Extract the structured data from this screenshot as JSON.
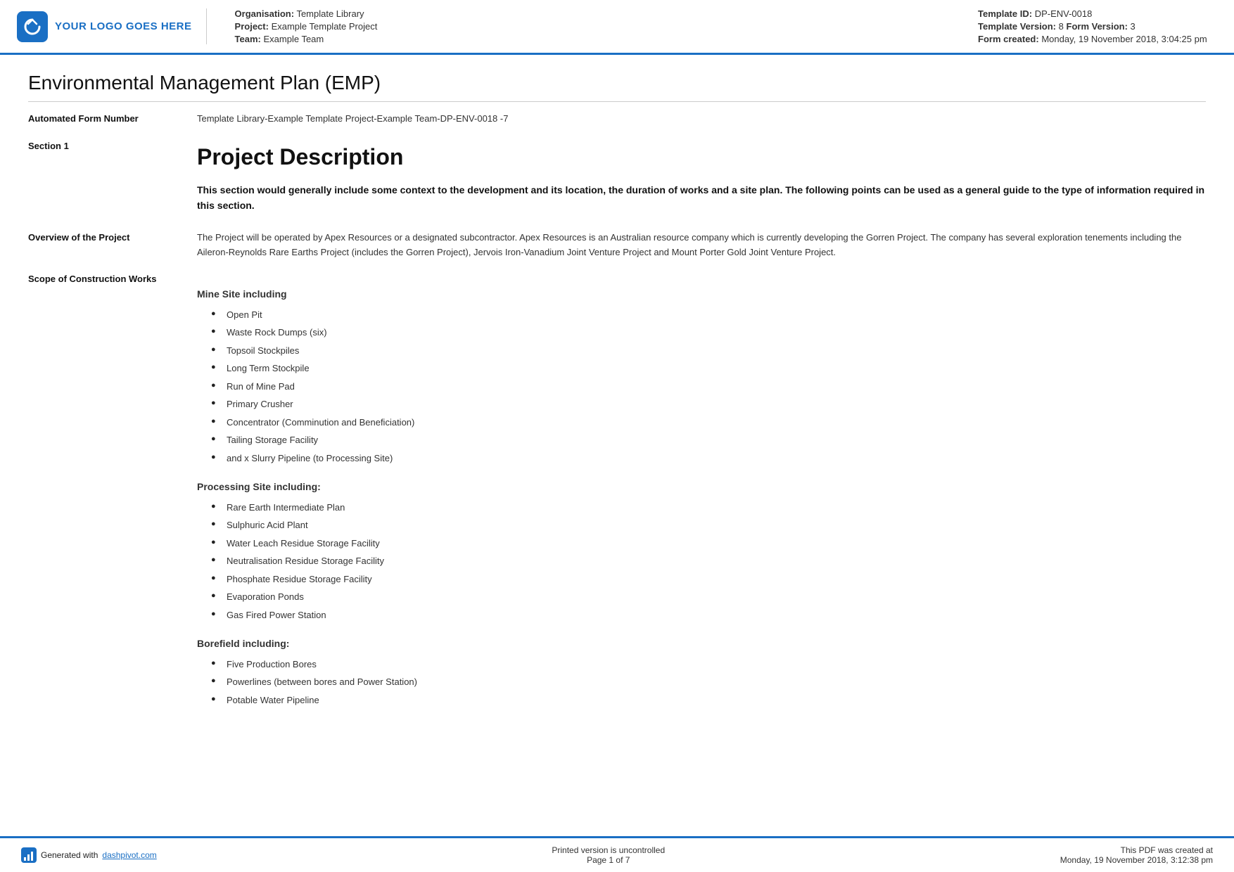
{
  "header": {
    "logo_text": "YOUR LOGO GOES HERE",
    "org_label": "Organisation:",
    "org_value": "Template Library",
    "project_label": "Project:",
    "project_value": "Example Template Project",
    "team_label": "Team:",
    "team_value": "Example Team",
    "template_id_label": "Template ID:",
    "template_id_value": "DP-ENV-0018",
    "template_version_label": "Template Version:",
    "template_version_value": "8",
    "form_version_label": "Form Version:",
    "form_version_value": "3",
    "form_created_label": "Form created:",
    "form_created_value": "Monday, 19 November 2018, 3:04:25 pm"
  },
  "page": {
    "title": "Environmental Management Plan (EMP)"
  },
  "automated_form": {
    "label": "Automated Form Number",
    "value": "Template Library-Example Template Project-Example Team-DP-ENV-0018   -7"
  },
  "section1": {
    "label": "Section 1",
    "heading": "Project Description",
    "intro": "This section would generally include some context to the development and its location, the duration of works and a site plan. The following points can be used as a general guide to the type of information required in this section."
  },
  "overview": {
    "label": "Overview of the Project",
    "text": "The Project will be operated by Apex Resources or a designated subcontractor. Apex Resources is an Australian resource company which is currently developing the Gorren Project. The company has several exploration tenements including the Aileron-Reynolds Rare Earths Project (includes the Gorren Project), Jervois Iron-Vanadium Joint Venture Project and Mount Porter Gold Joint Venture Project."
  },
  "scope": {
    "label": "Scope of Construction Works",
    "mine_site_title": "Mine Site including",
    "mine_site_items": [
      "Open Pit",
      "Waste Rock Dumps (six)",
      "Topsoil Stockpiles",
      "Long Term Stockpile",
      "Run of Mine Pad",
      "Primary Crusher",
      "Concentrator (Comminution and Beneficiation)",
      "Tailing Storage Facility",
      "and x Slurry Pipeline (to Processing Site)"
    ],
    "processing_site_title": "Processing Site including:",
    "processing_site_items": [
      "Rare Earth Intermediate Plan",
      "Sulphuric Acid Plant",
      "Water Leach Residue Storage Facility",
      "Neutralisation Residue Storage Facility",
      "Phosphate Residue Storage Facility",
      "Evaporation Ponds",
      "Gas Fired Power Station"
    ],
    "borefield_title": "Borefield including:",
    "borefield_items": [
      "Five Production Bores",
      "Powerlines (between bores and Power Station)",
      "Potable Water Pipeline"
    ]
  },
  "footer": {
    "generated_text": "Generated with",
    "generated_link": "dashpivot.com",
    "center_line1": "Printed version is uncontrolled",
    "center_line2": "Page 1 of 7",
    "right_line1": "This PDF was created at",
    "right_line2": "Monday, 19 November 2018, 3:12:38 pm"
  }
}
